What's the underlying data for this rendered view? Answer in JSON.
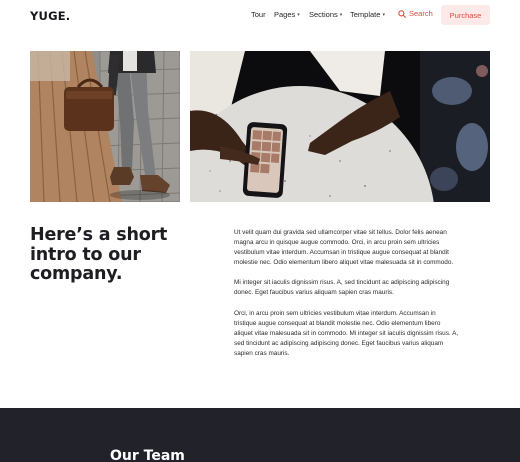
{
  "brand": {
    "logo": "YUGE."
  },
  "nav": {
    "tour": "Tour",
    "pages": "Pages",
    "sections": "Sections",
    "template": "Template",
    "search": "Search",
    "purchase": "Purchase"
  },
  "icons": {
    "dropdown": "chevron-down-icon",
    "search": "search-icon"
  },
  "colors": {
    "accent": "#e04a3f",
    "accent_bg": "#fde9e7",
    "dark_band": "#22232a"
  },
  "images": {
    "left": "person-with-leather-bag-photo",
    "right": "hands-holding-phone-photo"
  },
  "intro": {
    "title": "Here’s a short intro to our company.",
    "paragraphs": [
      "Ut velit quam dui gravida sed ullamcorper vitae sit tellus. Dolor felis aenean magna arcu in quisque augue commodo. Orci, in arcu proin sem ultricies vestibulum vitae interdum. Accumsan in tristique augue consequat at blandit molestie nec. Odio elementum libero aliquet vitae malesuada sit in commodo.",
      "Mi integer sit iaculis dignissim risus. A, sed tincidunt ac adipiscing adipiscing donec. Eget faucibus varius aliquam sapien cras mauris.",
      "Orci, in arcu proin sem ultricies vestibulum vitae interdum. Accumsan in tristique augue consequat at blandit molestie nec. Odio elementum libero aliquet vitae malesuada sit in commodo. Mi integer sit iaculis dignissim risus. A, sed tincidunt ac adipiscing adipiscing donec. Eget faucibus varius aliquam sapien cras mauris."
    ]
  },
  "team": {
    "title": "Our Team"
  }
}
